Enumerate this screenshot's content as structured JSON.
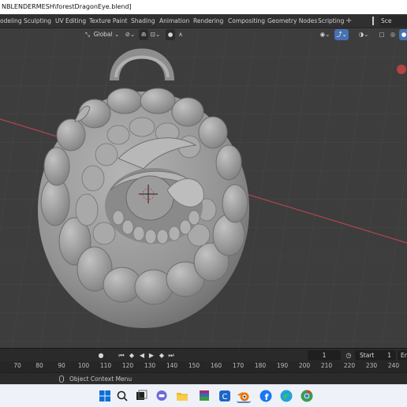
{
  "window": {
    "title": "NBLENDERMESH\\forestDragonEye.blend]"
  },
  "workspace_tabs": [
    {
      "label": "odeling"
    },
    {
      "label": "Sculpting"
    },
    {
      "label": "UV Editing"
    },
    {
      "label": "Texture Paint"
    },
    {
      "label": "Shading"
    },
    {
      "label": "Animation"
    },
    {
      "label": "Rendering"
    },
    {
      "label": "Compositing"
    },
    {
      "label": "Geometry Nodes"
    },
    {
      "label": "Scripting"
    }
  ],
  "add_workspace": "+",
  "scene": "Sce",
  "viewport_header": {
    "transform_orientation": "Global",
    "pivot_icon": "pivot-icon",
    "snap_icon": "magnet-icon",
    "proportional_icon": "proportional-editing-icon"
  },
  "timeline": {
    "current_frame": "1",
    "start_label": "Start",
    "start_value": "1",
    "end_label": "En"
  },
  "ruler": {
    "ticks": [
      "70",
      "80",
      "90",
      "100",
      "110",
      "120",
      "130",
      "140",
      "150",
      "160",
      "170",
      "180",
      "190",
      "200",
      "210",
      "220",
      "230",
      "240"
    ]
  },
  "status_bar": {
    "hint": "Object Context Menu"
  },
  "colors": {
    "viewport_bg": "#3d3d3d",
    "x_axis": "#b3454f",
    "accent": "#4772b3",
    "mesh": "#9a9a9a"
  },
  "taskbar_icons": [
    "windows-start-icon",
    "search-icon",
    "task-view-icon",
    "chat-icon",
    "file-explorer-icon",
    "winrar-icon",
    "app-icon",
    "calendar-icon",
    "blender-icon",
    "facebook-icon",
    "edge-icon",
    "chrome-icon"
  ]
}
